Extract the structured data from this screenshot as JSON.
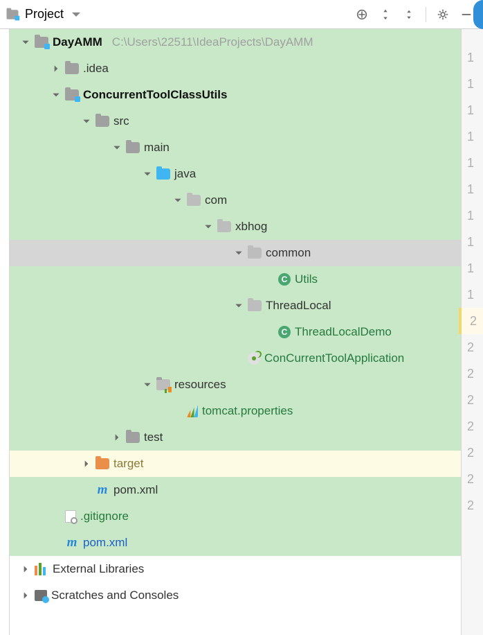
{
  "toolbar": {
    "title": "Project"
  },
  "gutter": [
    "1",
    "1",
    "1",
    "1",
    "1",
    "1",
    "1",
    "1",
    "1",
    "1",
    "2",
    "2",
    "2",
    "2",
    "2",
    "2",
    "2",
    "2"
  ],
  "gutter_warn_index": 10,
  "tree": {
    "root": {
      "name": "DayAMM",
      "path": "C:\\Users\\22511\\IdeaProjects\\DayAMM"
    },
    "idea": ".idea",
    "module": "ConcurrentToolClassUtils",
    "src": "src",
    "main": "main",
    "java": "java",
    "com": "com",
    "xbhog": "xbhog",
    "common": "common",
    "utils_class": "Utils",
    "threadlocal": "ThreadLocal",
    "threadlocal_demo": "ThreadLocalDemo",
    "app_class": "ConCurrentToolApplication",
    "resources": "resources",
    "tomcat_props": "tomcat.properties",
    "test": "test",
    "target": "target",
    "pom_inner": "pom.xml",
    "gitignore": ".gitignore",
    "pom_outer": "pom.xml",
    "ext_lib": "External Libraries",
    "scratches": "Scratches and Consoles"
  }
}
